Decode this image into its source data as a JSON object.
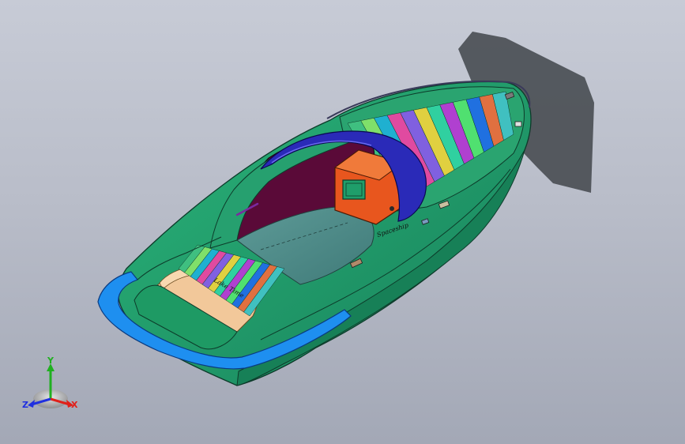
{
  "viewport": {
    "background_top": "#c7cbd6",
    "background_bottom": "#a3a8b6"
  },
  "model": {
    "hull_color": "#1f9e6a",
    "hull_shadow_color": "#4b4f55",
    "swim_platform_color": "#1e8ff0",
    "bow_shield_color": "#2a2ab8",
    "engine_box_color": "#e8561e",
    "cockpit_floor_color": "#4c8a88",
    "cockpit_wall_color": "#5a0a38",
    "seat_cushion_color": "#f2c89a",
    "deck_stripes": [
      "#3fbf80",
      "#7fe06a",
      "#1fb0d0",
      "#e04aa0",
      "#8060e0",
      "#e0d040",
      "#30d0a0",
      "#b040d0",
      "#50e070",
      "#2070e0",
      "#e07040",
      "#40c0c0"
    ],
    "transom_text": "Lake Time",
    "bow_text": "Spaceship"
  },
  "triad": {
    "x_label": "X",
    "y_label": "Y",
    "z_label": "Z",
    "x_color": "#e0201a",
    "y_color": "#20b020",
    "z_color": "#2030e0"
  }
}
